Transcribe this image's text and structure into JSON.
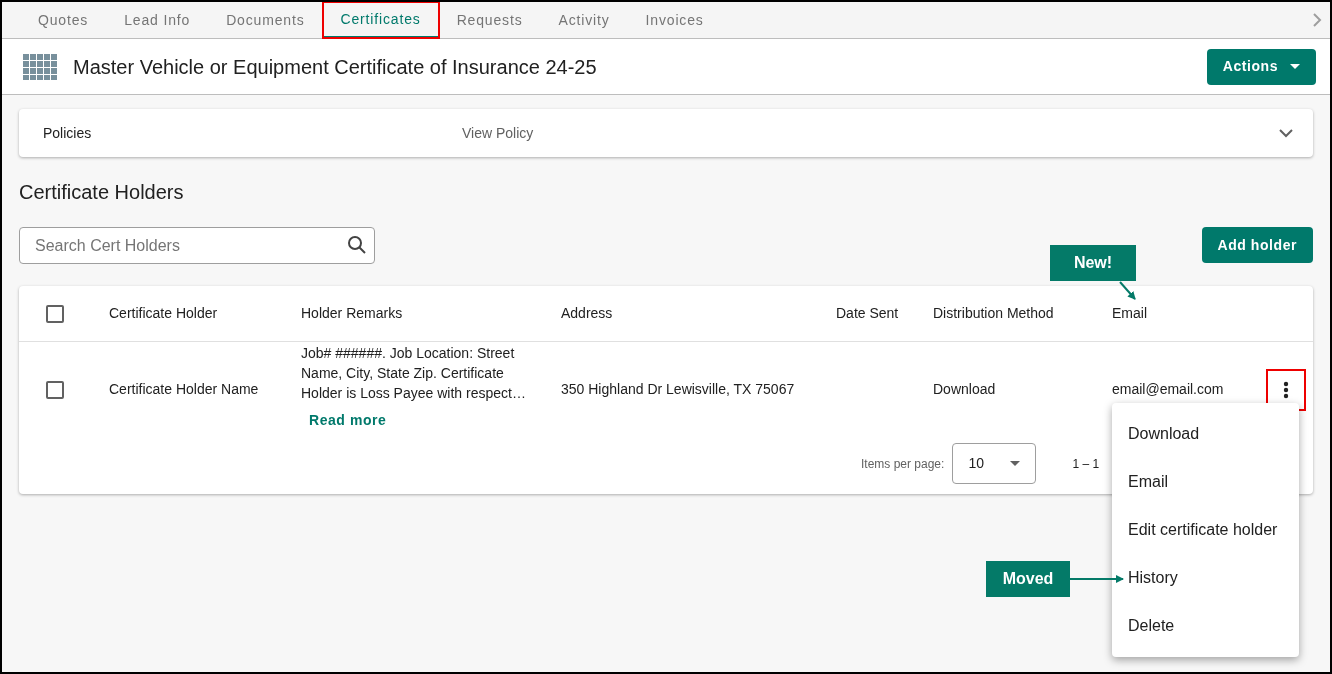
{
  "tabs": [
    {
      "label": "Quotes",
      "selected": false,
      "highlighted": false
    },
    {
      "label": "Lead Info",
      "selected": false,
      "highlighted": false
    },
    {
      "label": "Documents",
      "selected": false,
      "highlighted": false
    },
    {
      "label": "Certificates",
      "selected": true,
      "highlighted": true
    },
    {
      "label": "Requests",
      "selected": false,
      "highlighted": false
    },
    {
      "label": "Activity",
      "selected": false,
      "highlighted": false
    },
    {
      "label": "Invoices",
      "selected": false,
      "highlighted": false
    }
  ],
  "header": {
    "title": "Master Vehicle or Equipment Certificate of Insurance 24-25",
    "actions_button": "Actions"
  },
  "policies": {
    "label": "Policies",
    "link": "View Policy",
    "expanded": false
  },
  "section_title": "Certificate Holders",
  "search": {
    "placeholder": "Search Cert Holders"
  },
  "add_button": "Add holder",
  "table": {
    "columns": [
      "Certificate Holder",
      "Holder Remarks",
      "Address",
      "Date Sent",
      "Distribution Method",
      "Email"
    ],
    "select_all_checked": false,
    "rows": [
      {
        "checked": false,
        "holder": "Certificate Holder Name",
        "remarks": "Job# ######. Job Location: Street Name, City, State Zip. Certificate Holder is Loss Payee with respect…",
        "read_more": "Read more",
        "address": "350 Highland Dr Lewisville, TX 75067",
        "date_sent": "",
        "method": "Download",
        "email": "email@email.com",
        "menu_highlighted": true
      }
    ],
    "pagination": {
      "label": "Items per page:",
      "page_size": "10",
      "range": "1 – 1"
    }
  },
  "row_menu": {
    "items": [
      "Download",
      "Email",
      "Edit certificate holder",
      "History",
      "Delete"
    ]
  },
  "callouts": [
    {
      "kind": "new",
      "text": "New!"
    },
    {
      "kind": "moved",
      "text": "Moved"
    }
  ]
}
